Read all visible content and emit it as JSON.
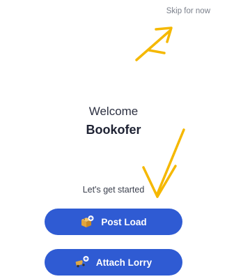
{
  "header": {
    "skip_label": "Skip for now"
  },
  "main": {
    "welcome_text": "Welcome",
    "user_name": "Bookofer",
    "prompt_text": "Let's get started"
  },
  "actions": {
    "post_load_label": "Post Load",
    "post_load_icon": "box-plus-icon",
    "attach_lorry_label": "Attach Lorry",
    "attach_lorry_icon": "truck-plus-icon"
  },
  "colors": {
    "button_bg": "#2f5bd3",
    "annotation_arrow": "#f5b800",
    "skip_text": "#7a7f8a"
  }
}
